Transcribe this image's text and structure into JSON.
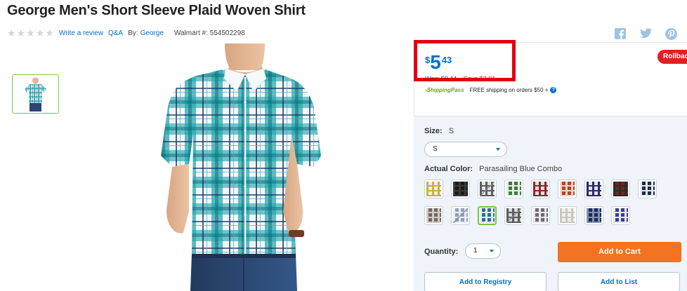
{
  "product": {
    "title": "George Men's Short Sleeve Plaid Woven Shirt",
    "write_review": "Write a review",
    "qa": "Q&A",
    "by_label": "By:",
    "brand": "George",
    "walmart_number": "Walmart #: 554502298",
    "rating": 0,
    "rating_max": 5
  },
  "social": {
    "icons": [
      "facebook-icon",
      "twitter-icon",
      "pinterest-icon"
    ]
  },
  "price": {
    "currency": "$",
    "dollars": "5",
    "cents": "43",
    "was": "Was: $8.44",
    "save": "Save $3.01",
    "badge": "Rollback",
    "shipping_pass": "ShippingPass",
    "free_shipping": "FREE shipping on orders $50 +",
    "info_glyph": "?"
  },
  "size": {
    "label": "Size:",
    "value": "S",
    "selected": "S"
  },
  "color": {
    "label": "Actual Color:",
    "value": "Parasailing Blue Combo",
    "selected_index": 11,
    "swatches": [
      {
        "base": "#f2f0e6",
        "stripe": "#c9b040"
      },
      {
        "base": "#1a1a1a",
        "stripe": "#3a3a3a"
      },
      {
        "base": "#e9e5da",
        "stripe": "#5b5b6b",
        "unavailable": true
      },
      {
        "base": "#3c7a3c",
        "stripe": "#e8eee8"
      },
      {
        "base": "#e8e0e0",
        "stripe": "#8a2a2a"
      },
      {
        "base": "#b8402a",
        "stripe": "#f1d6c8"
      },
      {
        "base": "#e6e6f0",
        "stripe": "#2a2a6a"
      },
      {
        "base": "#6a2a1a",
        "stripe": "#2a2a2a"
      },
      {
        "base": "#1a2a4a",
        "stripe": "#e8e8f0"
      },
      {
        "base": "#6a6a6a",
        "stripe": "#d8c8c0"
      },
      {
        "base": "#8fa0c0",
        "stripe": "#e8ecf4",
        "unavailable": true
      },
      {
        "base": "#2a6ab0",
        "stripe": "#e8f0f6"
      },
      {
        "base": "#d8d8d8",
        "stripe": "#5a5a5a",
        "unavailable": true
      },
      {
        "base": "#6a6a7a",
        "stripe": "#e8e8ec"
      },
      {
        "base": "#f0f0ea",
        "stripe": "#c8c8c0"
      },
      {
        "base": "#1a2a5a",
        "stripe": "#8090b0"
      },
      {
        "base": "#3a3aa0",
        "stripe": "#e8e8f8"
      }
    ]
  },
  "quantity": {
    "label": "Quantity:",
    "value": "1"
  },
  "actions": {
    "add_to_cart": "Add to Cart",
    "add_to_registry": "Add to Registry",
    "add_to_list": "Add to List"
  },
  "colors": {
    "walmart_blue": "#0071ce",
    "rollback_red": "#e02020",
    "cart_orange": "#f47321",
    "highlight_red": "#e1000f"
  }
}
